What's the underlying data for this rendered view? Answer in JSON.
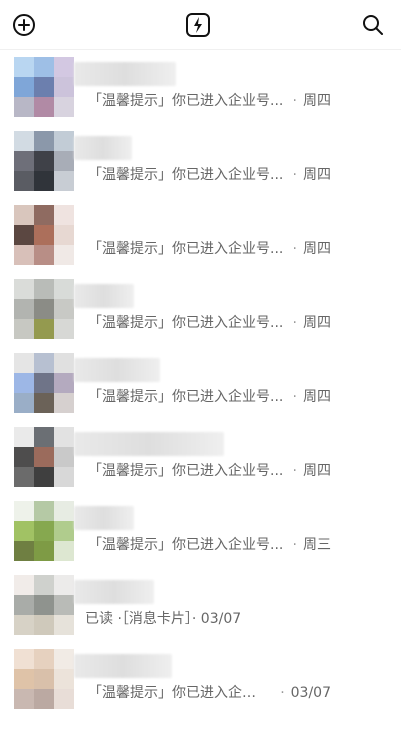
{
  "topbar": {
    "left_icon": "add-circle-icon",
    "center_icon": "flash-icon",
    "right_icon": "search-icon"
  },
  "rows": [
    {
      "preview": "「温馨提示」你已进入企业号...",
      "time": "周四",
      "avatar_colors": [
        "#b9d6f1",
        "#9ebfe6",
        "#d3c8e2",
        "#7fa6d8",
        "#6c7fae",
        "#ccc3db",
        "#b8b7c6",
        "#b18aa5",
        "#d8d3df"
      ]
    },
    {
      "preview": "「温馨提示」你已进入企业号...",
      "time": "周四",
      "avatar_colors": [
        "#d2dbe3",
        "#8b98aa",
        "#c2ccd6",
        "#6e6f79",
        "#3f4148",
        "#a8adb7",
        "#5a5c63",
        "#30343a",
        "#c8cdd4"
      ]
    },
    {
      "preview": "「温馨提示」你已进入企业号...",
      "time": "周四",
      "avatar_colors": [
        "#d9c6bd",
        "#8f6b61",
        "#efe3e0",
        "#5b4741",
        "#ac6f5b",
        "#e7d8d2",
        "#d8c0b9",
        "#b88e86",
        "#f0e9e6"
      ]
    },
    {
      "preview": "「温馨提示」你已进入企业号...",
      "time": "周四",
      "avatar_colors": [
        "#dadcd9",
        "#b9bcb8",
        "#d8dbd8",
        "#b2b4b0",
        "#8b8c86",
        "#c8c9c5",
        "#c7c8c2",
        "#949a4f",
        "#d7d8d5"
      ]
    },
    {
      "preview": "「温馨提示」你已进入企业号...",
      "time": "周四",
      "avatar_colors": [
        "#e5e5e5",
        "#b7c0d1",
        "#e0e0e0",
        "#9db7e6",
        "#6f7488",
        "#b4aabf",
        "#9aaec7",
        "#6b6258",
        "#d6d0cf"
      ]
    },
    {
      "preview": "「温馨提示」你已进入企业号...",
      "time": "周四",
      "avatar_colors": [
        "#eaeaea",
        "#6b6f74",
        "#e2e2e2",
        "#4e4d4d",
        "#9b6b5c",
        "#c9c9c9",
        "#6b6b6b",
        "#3f3f3f",
        "#d8d8d8"
      ]
    },
    {
      "preview": "「温馨提示」你已进入企业号...",
      "time": "周三",
      "avatar_colors": [
        "#eef2ea",
        "#b5c9a5",
        "#e7ece3",
        "#a1c264",
        "#86a84f",
        "#b0cc8d",
        "#6f7f42",
        "#7e9b45",
        "#dde7d1"
      ]
    },
    {
      "preview": "已读 ·［消息卡片］· 03/07",
      "time": "",
      "avatar_colors": [
        "#f1ece9",
        "#cfd1cd",
        "#ecebea",
        "#a9aca8",
        "#8f938e",
        "#b9bbb7",
        "#d7d2c6",
        "#cfc9bb",
        "#e6e2da"
      ]
    },
    {
      "preview": "「温馨提示」你已进入企业...",
      "time": "03/07",
      "avatar_colors": [
        "#f0e0d3",
        "#e6d1bf",
        "#f1ebe5",
        "#dfc3a8",
        "#d9c0aa",
        "#ece3da",
        "#c9b8b1",
        "#bba9a2",
        "#e8ddd7"
      ]
    }
  ]
}
